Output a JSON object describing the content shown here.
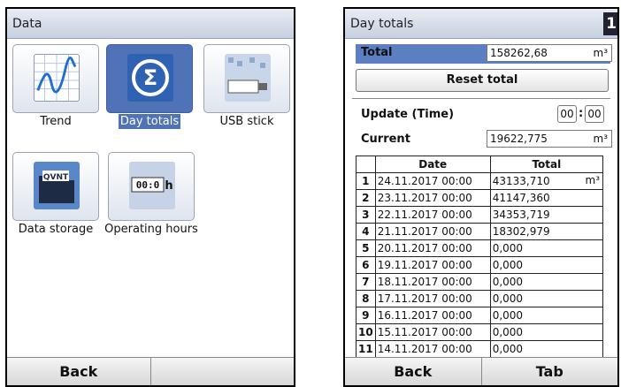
{
  "left": {
    "title": "Data",
    "tiles": [
      {
        "label": "Trend",
        "icon": "trend-icon",
        "selected": false
      },
      {
        "label": "Day totals",
        "icon": "sigma-icon",
        "selected": true
      },
      {
        "label": "USB stick",
        "icon": "usb-stick-icon",
        "selected": false
      },
      {
        "label": "Data storage",
        "icon": "data-storage-icon",
        "selected": false
      },
      {
        "label": "Operating hours",
        "icon": "operating-hours-icon",
        "selected": false
      }
    ],
    "softkeys": [
      "Back",
      ""
    ],
    "storage_icon_text": "QVNT",
    "hours_icon_text": "00:0",
    "hours_icon_unit": "h"
  },
  "right": {
    "title": "Day totals",
    "badge": "1",
    "total": {
      "label": "Total",
      "value": "158262,68",
      "unit": "m³"
    },
    "reset_label": "Reset total",
    "update": {
      "label": "Update (Time)",
      "hours": "00",
      "minutes": "00"
    },
    "current": {
      "label": "Current",
      "value": "19622,775",
      "unit": "m³"
    },
    "table": {
      "headers": [
        "",
        "Date",
        "Total"
      ],
      "unit": "m³",
      "rows": [
        {
          "idx": "1",
          "date": "24.11.2017 00:00",
          "total": "43133,710"
        },
        {
          "idx": "2",
          "date": "23.11.2017 00:00",
          "total": "41147,360"
        },
        {
          "idx": "3",
          "date": "22.11.2017 00:00",
          "total": "34353,719"
        },
        {
          "idx": "4",
          "date": "21.11.2017 00:00",
          "total": "18302,979"
        },
        {
          "idx": "5",
          "date": "20.11.2017 00:00",
          "total": "0,000"
        },
        {
          "idx": "6",
          "date": "19.11.2017 00:00",
          "total": "0,000"
        },
        {
          "idx": "7",
          "date": "18.11.2017 00:00",
          "total": "0,000"
        },
        {
          "idx": "8",
          "date": "17.11.2017 00:00",
          "total": "0,000"
        },
        {
          "idx": "9",
          "date": "16.11.2017 00:00",
          "total": "0,000"
        },
        {
          "idx": "10",
          "date": "15.11.2017 00:00",
          "total": "0,000"
        },
        {
          "idx": "11",
          "date": "14.11.2017 00:00",
          "total": "0,000"
        }
      ]
    },
    "softkeys": [
      "Back",
      "Tab"
    ]
  },
  "colors": {
    "selection": "#4f73b6",
    "title_bar": "#c6d0e0"
  }
}
